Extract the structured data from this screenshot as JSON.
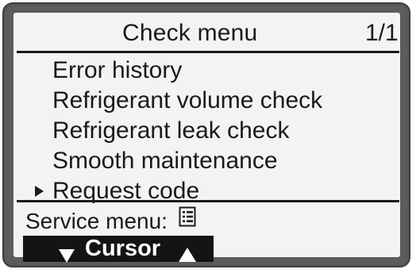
{
  "header": {
    "title": "Check menu",
    "page_indicator": "1/1"
  },
  "menu": {
    "items": [
      {
        "label": "Error history",
        "selected": false
      },
      {
        "label": "Refrigerant volume check",
        "selected": false
      },
      {
        "label": "Refrigerant leak check",
        "selected": false
      },
      {
        "label": "Smooth maintenance",
        "selected": false
      },
      {
        "label": "Request code",
        "selected": true
      }
    ]
  },
  "footer": {
    "service_label": "Service menu:",
    "service_icon": "list-menu-icon",
    "cursor_label": "Cursor",
    "cursor_icons": [
      "down-triangle-icon",
      "up-triangle-icon"
    ]
  },
  "colors": {
    "bezel": "#5c5c5c",
    "screen_background": "#f4f3f1",
    "text": "#1a1a1a",
    "cursor_bar_background": "#141414",
    "cursor_bar_text": "#ffffff"
  }
}
